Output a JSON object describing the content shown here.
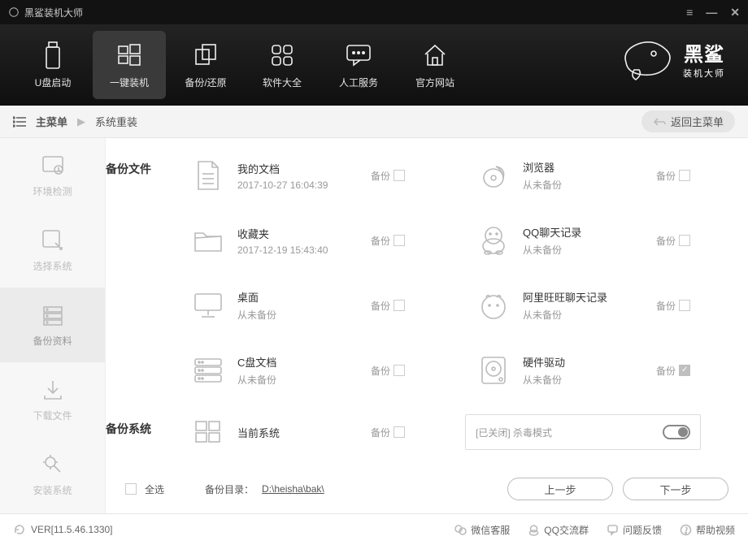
{
  "window": {
    "title": "黑鲨装机大师"
  },
  "topnav": [
    {
      "label": "U盘启动"
    },
    {
      "label": "一键装机"
    },
    {
      "label": "备份/还原"
    },
    {
      "label": "软件大全"
    },
    {
      "label": "人工服务"
    },
    {
      "label": "官方网站"
    }
  ],
  "logo": {
    "line1": "黑鲨",
    "line2": "装机大师"
  },
  "breadcrumb": {
    "root": "主菜单",
    "current": "系统重装",
    "back": "返回主菜单"
  },
  "sidebar": [
    {
      "label": "环境检测"
    },
    {
      "label": "选择系统"
    },
    {
      "label": "备份资料"
    },
    {
      "label": "下载文件"
    },
    {
      "label": "安装系统"
    }
  ],
  "sections": {
    "files": "备份文件",
    "system": "备份系统"
  },
  "backup_label": "备份",
  "items_left": [
    {
      "title": "我的文档",
      "sub": "2017-10-27 16:04:39",
      "checked": false
    },
    {
      "title": "收藏夹",
      "sub": "2017-12-19 15:43:40",
      "checked": false
    },
    {
      "title": "桌面",
      "sub": "从未备份",
      "checked": false
    },
    {
      "title": "C盘文档",
      "sub": "从未备份",
      "checked": false
    }
  ],
  "items_right": [
    {
      "title": "浏览器",
      "sub": "从未备份",
      "checked": false
    },
    {
      "title": "QQ聊天记录",
      "sub": "从未备份",
      "checked": false
    },
    {
      "title": "阿里旺旺聊天记录",
      "sub": "从未备份",
      "checked": false
    },
    {
      "title": "硬件驱动",
      "sub": "从未备份",
      "checked": true
    }
  ],
  "system_item": {
    "title": "当前系统",
    "sub": "",
    "checked": false
  },
  "antivirus": {
    "status": "[已关闭]",
    "label": "杀毒模式"
  },
  "bottom": {
    "select_all": "全选",
    "dir_label": "备份目录：",
    "dir_value": "D:\\heisha\\bak\\",
    "prev": "上一步",
    "next": "下一步"
  },
  "statusbar": {
    "version": "VER[11.5.46.1330]",
    "links": [
      "微信客服",
      "QQ交流群",
      "问题反馈",
      "帮助视频"
    ]
  }
}
